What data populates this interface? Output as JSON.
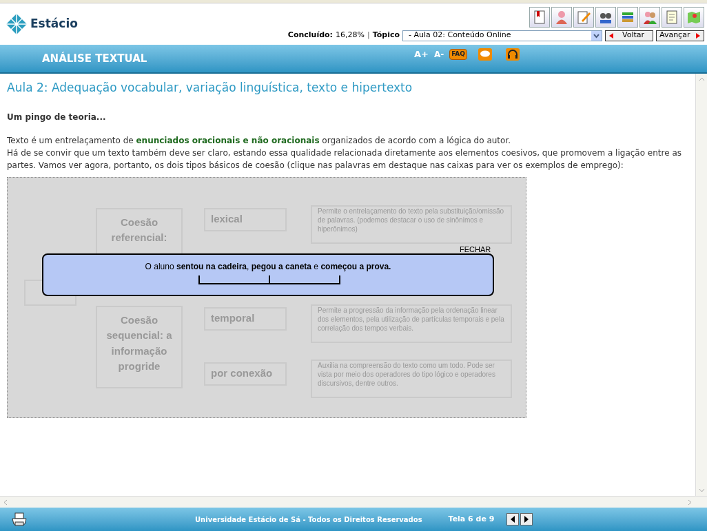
{
  "header": {
    "logo": "Estácio",
    "progress_label": "Concluído:",
    "progress_value": "16,28%",
    "separator": "|",
    "topic_label": "Tópico",
    "topic_select": "- Aula 02: Conteúdo Online",
    "back_button": "Voltar",
    "next_button": "Avançar"
  },
  "title_bar": {
    "course": "ANÁLISE TEXTUAL",
    "font_increase": "A+",
    "font_decrease": "A-",
    "faq": "FAQ"
  },
  "lesson": {
    "title": "Aula 2: Adequação vocabular, variação linguística, texto e hipertexto",
    "subtitle": "Um pingo de teoria...",
    "paragraphs": [
      "Texto é um entrelaçamento de **enunciados oracionais e não oracionais** organizados de acordo com a lógica do autor.",
      "Há de se convir que um texto também deve ser claro, estando essa qualidade relacionada diretamente aos elementos coesivos, que promovem a ligação entre as partes. Vamos ver agora, portanto, os dois tipos básicos de coesão (clique nas palavras em destaque nas caixas para ver os exemplos de emprego):"
    ]
  },
  "diagram": {
    "groups": [
      {
        "name": "Coesão referencial:",
        "types": [
          {
            "label": "lexical",
            "description": "Permite o entrelaçamento do texto pela substituição/omissão de palavras. (podemos destacar o uso de sinônimos e hiperônimos)"
          }
        ]
      },
      {
        "name": "Coesão sequencial: a informação progride",
        "types": [
          {
            "label": "temporal",
            "description": "Permite a progressão da informação pela ordenação linear dos elementos, pela utilização de partículas temporais e pela correlação dos tempos verbais."
          },
          {
            "label": "por conexão",
            "description": "Auxilia na compreensão do texto como um todo. Pode ser vista por meio dos operadores do tipo lógico e operadores discursivos, dentre outros."
          }
        ]
      }
    ]
  },
  "popup": {
    "close": "FECHAR",
    "example": "O aluno **sentou na cadeira**, **pegou a caneta** e **começou a prova.**"
  },
  "footer": {
    "copyright": "Universidade Estácio de Sá - Todos os Direitos Reservados",
    "page": "Tela 6 de 9"
  }
}
